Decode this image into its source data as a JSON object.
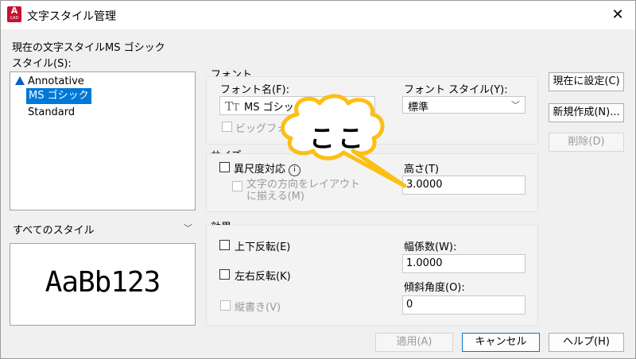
{
  "window": {
    "title": "文字スタイル管理",
    "app_icon": "A",
    "app_icon_sub": "CAD",
    "close_glyph": "✕"
  },
  "current_style": {
    "label": "現在の文字スタイルMS ゴシック"
  },
  "styles": {
    "label": "スタイル(S):",
    "items": [
      "Annotative",
      "MS ゴシック",
      "Standard"
    ],
    "selected": "MS ゴシック",
    "filter": "すべてのスタイル"
  },
  "preview": {
    "text": "AaBb123"
  },
  "font": {
    "group_label": "フォント",
    "name_label": "フォント名(F):",
    "name_value": "MS ゴシック",
    "style_label": "フォント スタイル(Y):",
    "style_value": "標準",
    "bigfont_label": "ビッグフォン"
  },
  "size": {
    "group_label": "サイズ",
    "annotative_label": "異尺度対応",
    "info_glyph": "i",
    "orient_label_line1": "文字の方向をレイアウト",
    "orient_label_line2": "に揃える(M)",
    "height_label": "高さ(T)",
    "height_value": "3.0000"
  },
  "effects": {
    "group_label": "効果",
    "upside_down": "上下反転(E)",
    "backwards": "左右反転(K)",
    "vertical": "縦書き(V)",
    "width_label": "幅係数(W):",
    "width_value": "1.0000",
    "oblique_label": "傾斜角度(O):",
    "oblique_value": "0"
  },
  "buttons": {
    "set_current": "現在に設定(C)",
    "new": "新規作成(N)...",
    "delete": "削除(D)",
    "apply": "適用(A)",
    "cancel": "キャンセル",
    "help": "ヘルプ(H)"
  },
  "callout": {
    "text": "ここ",
    "color": "#fbbf16"
  },
  "colors": {
    "selection": "#0078d7",
    "brand_red": "#c8102e"
  }
}
